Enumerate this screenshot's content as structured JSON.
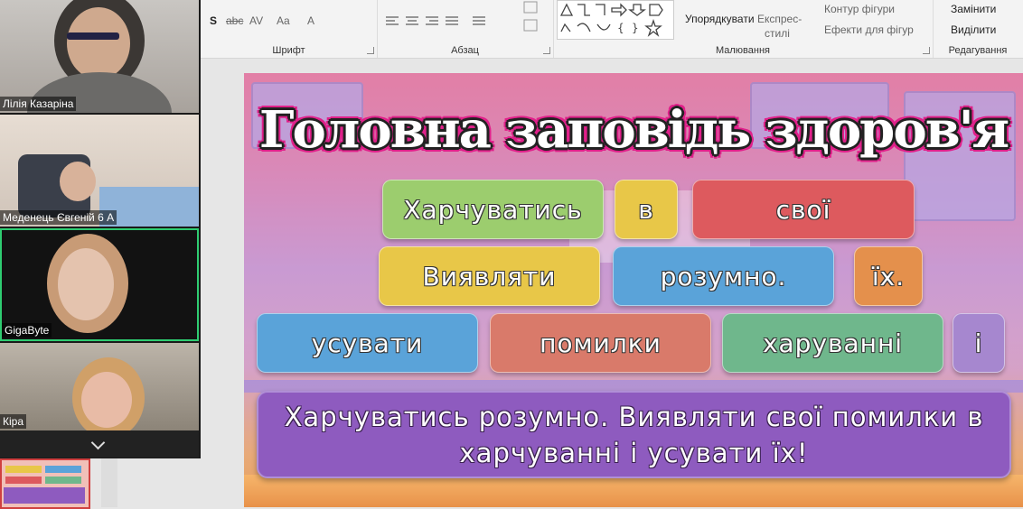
{
  "ribbon": {
    "font_group_label": "Шрифт",
    "paragraph_group_label": "Абзац",
    "drawing_group_label": "Малювання",
    "editing_group_label": "Редагування",
    "font_buttons": [
      "S",
      "abc",
      "AV",
      "Aa",
      "A"
    ],
    "arrange_label": "Упорядкувати",
    "quick_styles_label_1": "Експрес-",
    "quick_styles_label_2": "стилі",
    "shape_outline_label": "Контур фігури",
    "shape_effects_label": "Ефекти для фігур",
    "replace_label": "Замінити",
    "select_label": "Виділити"
  },
  "slide": {
    "title": "Головна заповідь здоров'я",
    "tiles": [
      {
        "text": "Харчуватись"
      },
      {
        "text": "в"
      },
      {
        "text": "свої"
      },
      {
        "text": "Виявляти"
      },
      {
        "text": "розумно."
      },
      {
        "text": "їх."
      },
      {
        "text": "усувати"
      },
      {
        "text": "помилки"
      },
      {
        "text": "харуванні"
      },
      {
        "text": "і"
      }
    ],
    "sentence": "Харчуватись розумно. Виявляти свої помилки в харчуванні і усувати їх!"
  },
  "videos": [
    {
      "name": "Лілія Казаріна"
    },
    {
      "name": "Меденець Євгеній 6 А"
    },
    {
      "name": "GigaByte"
    },
    {
      "name": "Кіра"
    }
  ],
  "colors": {
    "active_speaker_border": "#2ecc71",
    "title_outline": "#e0208a",
    "sentence_box": "#8e5bbf"
  }
}
